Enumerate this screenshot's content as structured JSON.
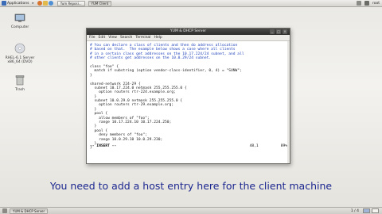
{
  "top_panel": {
    "applications_label": "Applications",
    "tasks": [
      {
        "label": "Yum Reposi..."
      },
      {
        "label": "YUM Client"
      }
    ],
    "user": "root"
  },
  "desktop": {
    "icons": [
      {
        "label": "Computer"
      },
      {
        "label": "RHEL-6.1 Server x86_64 (DVD)"
      },
      {
        "label": "Trash"
      }
    ]
  },
  "window": {
    "title": "YUM & DHCP Server",
    "menu": [
      "File",
      "Edit",
      "View",
      "Search",
      "Terminal",
      "Help"
    ]
  },
  "terminal": {
    "lines": [
      {
        "text": "# You can declare a class of clients and then do address allocation",
        "color": "blue"
      },
      {
        "text": "# based on that.  The example below shows a case where all clients",
        "color": "blue"
      },
      {
        "text": "# in a certain class get addresses on the 10.17.224/24 subnet, and all",
        "color": "blue"
      },
      {
        "text": "# other clients get addresses on the 10.0.29/24 subnet.",
        "color": "blue"
      },
      {
        "text": "",
        "color": "black"
      },
      {
        "text": "class \"foo\" {",
        "color": "black"
      },
      {
        "text": "  match if substring (option vendor-class-identifier, 0, 4) = \"SUNW\";",
        "color": "black"
      },
      {
        "text": "}",
        "color": "black"
      },
      {
        "text": "",
        "color": "black"
      },
      {
        "text": "shared-network 224-29 {",
        "color": "black"
      },
      {
        "text": "  subnet 10.17.224.0 netmask 255.255.255.0 {",
        "color": "black"
      },
      {
        "text": "    option routers rtr-224.example.org;",
        "color": "black"
      },
      {
        "text": "  }",
        "color": "black"
      },
      {
        "text": "  subnet 10.0.29.0 netmask 255.255.255.0 {",
        "color": "black"
      },
      {
        "text": "    option routers rtr-29.example.org;",
        "color": "black"
      },
      {
        "text": "  }",
        "color": "black"
      },
      {
        "text": "  pool {",
        "color": "black"
      },
      {
        "text": "    allow members of \"foo\";",
        "color": "black"
      },
      {
        "text": "    range 10.17.224.10 10.17.224.250;",
        "color": "black"
      },
      {
        "text": "  }",
        "color": "black"
      },
      {
        "text": "  pool {",
        "color": "black"
      },
      {
        "text": "    deny members of \"foo\";",
        "color": "black"
      },
      {
        "text": "    range 10.0.29.10 10.0.29.230;",
        "color": "black"
      },
      {
        "text": "  }",
        "color": "black"
      },
      {
        "text": "}",
        "color": "black"
      }
    ],
    "status_mode": "-- INSERT --",
    "status_pos": "48,1",
    "status_pct": "89%"
  },
  "caption": "You need to add a host entry here for the client machine",
  "bottom_panel": {
    "task_label": "YUM & DHCP Server",
    "workspace_label": "1 / 4"
  },
  "colors": {
    "caption": "#1b2690",
    "comment": "#1c3fb9"
  }
}
